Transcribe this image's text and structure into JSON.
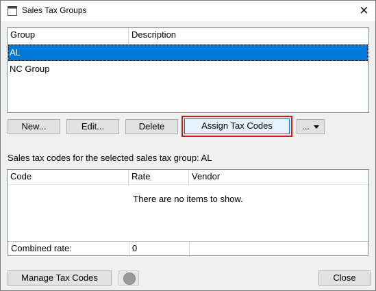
{
  "window": {
    "title": "Sales Tax Groups",
    "close_glyph": "✕",
    "icon": "window-icon"
  },
  "groups_list": {
    "columns": [
      "Group",
      "Description"
    ],
    "rows": [
      {
        "group": "AL",
        "description": "",
        "selected": true
      },
      {
        "group": "NC Group",
        "description": "",
        "selected": false
      }
    ]
  },
  "actions": {
    "new": "New...",
    "edit": "Edit...",
    "delete": "Delete",
    "assign": "Assign Tax Codes",
    "more": "..."
  },
  "codes_section": {
    "label": "Sales tax codes for the selected sales tax group: AL",
    "columns": [
      "Code",
      "Rate",
      "Vendor"
    ],
    "empty_message": "There are no items to show.",
    "combined_rate_label": "Combined rate:",
    "combined_rate_value": "0"
  },
  "footer": {
    "manage": "Manage Tax Codes",
    "close": "Close"
  },
  "colors": {
    "selection": "#0078d7",
    "highlight_border": "#d0191f"
  }
}
